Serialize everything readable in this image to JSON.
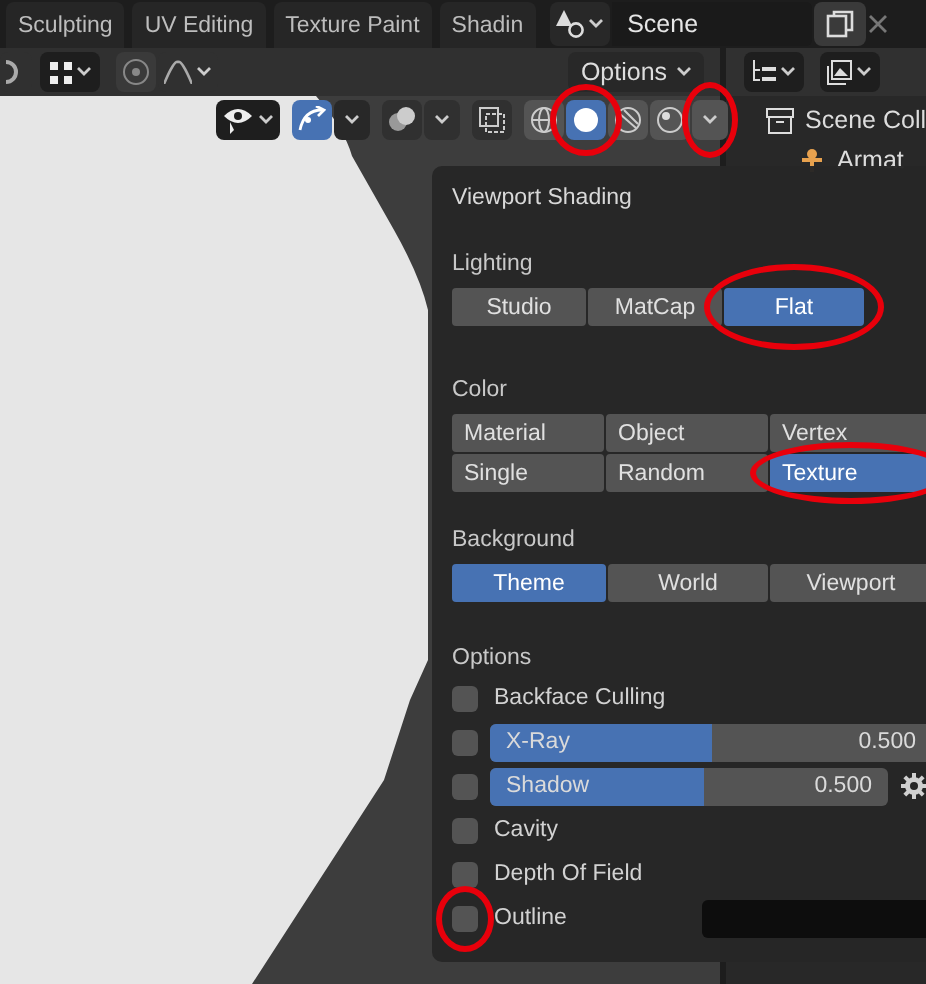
{
  "workspace_tabs": [
    {
      "label": "Sculpting",
      "selected": false
    },
    {
      "label": "UV Editing",
      "selected": false
    },
    {
      "label": "Texture Paint",
      "selected": false
    },
    {
      "label": "Shadin",
      "selected": false
    }
  ],
  "scene": {
    "name": "Scene"
  },
  "viewport_header": {
    "options_label": "Options"
  },
  "shading_modes": [
    {
      "kind": "wireframe",
      "selected": false
    },
    {
      "kind": "solid",
      "selected": true,
      "circled": true
    },
    {
      "kind": "material",
      "selected": false
    },
    {
      "kind": "rendered",
      "selected": false
    }
  ],
  "shading_popover_toggle": {
    "circled": true
  },
  "outliner": {
    "items": [
      {
        "label": "Scene Coll",
        "kind": "collection"
      },
      {
        "label": "Armat",
        "kind": "armature"
      }
    ]
  },
  "viewport_shading": {
    "title": "Viewport Shading",
    "lighting": {
      "label": "Lighting",
      "options": [
        {
          "label": "Studio",
          "selected": false,
          "circled": false
        },
        {
          "label": "MatCap",
          "selected": false,
          "circled": false
        },
        {
          "label": "Flat",
          "selected": true,
          "circled": true
        }
      ]
    },
    "color": {
      "label": "Color",
      "options": [
        {
          "label": "Material",
          "selected": false,
          "circled": false
        },
        {
          "label": "Object",
          "selected": false,
          "circled": false
        },
        {
          "label": "Vertex",
          "selected": false,
          "circled": false
        },
        {
          "label": "Single",
          "selected": false,
          "circled": false
        },
        {
          "label": "Random",
          "selected": false,
          "circled": false
        },
        {
          "label": "Texture",
          "selected": true,
          "circled": true
        }
      ]
    },
    "background": {
      "label": "Background",
      "options": [
        {
          "label": "Theme",
          "selected": true,
          "circled": false
        },
        {
          "label": "World",
          "selected": false,
          "circled": false
        },
        {
          "label": "Viewport",
          "selected": false,
          "circled": false
        }
      ]
    },
    "options": {
      "label": "Options",
      "rows": [
        {
          "kind": "checkbox",
          "label": "Backface Culling",
          "checked": false,
          "circled": false
        },
        {
          "kind": "slider",
          "label": "X-Ray",
          "checked": false,
          "level": 0.5,
          "reading": "0.500"
        },
        {
          "kind": "slider",
          "label": "Shadow",
          "checked": false,
          "level": 0.54,
          "reading": "0.500",
          "settings": true
        },
        {
          "kind": "checkbox",
          "label": "Cavity",
          "checked": false,
          "circled": false
        },
        {
          "kind": "checkbox",
          "label": "Depth Of Field",
          "checked": false,
          "circled": false
        },
        {
          "kind": "color",
          "label": "Outline",
          "checked": false,
          "circled": true
        }
      ]
    }
  }
}
